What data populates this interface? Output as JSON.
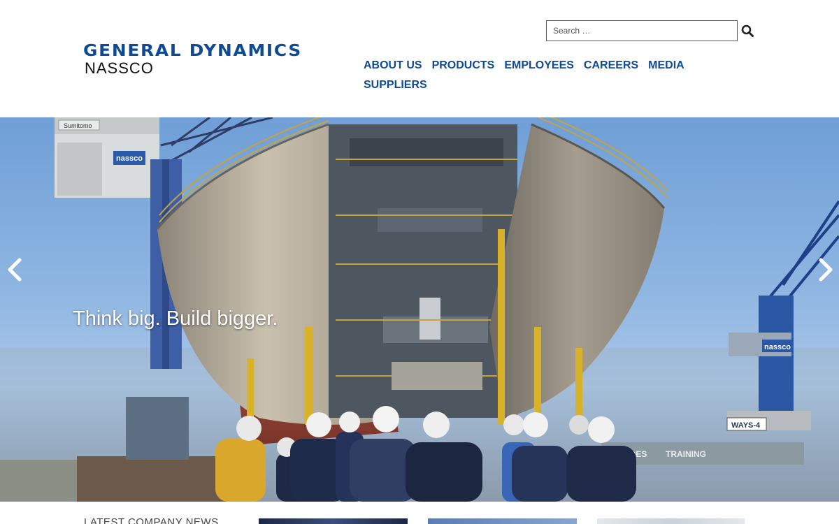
{
  "brand": {
    "name_top": "GENERAL DYNAMICS",
    "name_bottom": "NASSCO",
    "color": "#0f4a95"
  },
  "search": {
    "placeholder": "Search …",
    "icon": "search-icon"
  },
  "nav": {
    "items": [
      {
        "label": "ABOUT US"
      },
      {
        "label": "PRODUCTS"
      },
      {
        "label": "EMPLOYEES"
      },
      {
        "label": "CAREERS"
      },
      {
        "label": "MEDIA"
      },
      {
        "label": "SUPPLIERS"
      }
    ]
  },
  "hero": {
    "caption": "Think big. Build bigger.",
    "prev_icon": "chevron-left-icon",
    "next_icon": "chevron-right-icon",
    "signs": {
      "sumitomo": "Sumitomo",
      "nassco_crane": "nassco",
      "nassco_right": "nassco",
      "ways": "WAYS-4",
      "trades": "TRADES",
      "training": "TRAINING"
    }
  },
  "news": {
    "heading": "LATEST COMPANY NEWS"
  }
}
